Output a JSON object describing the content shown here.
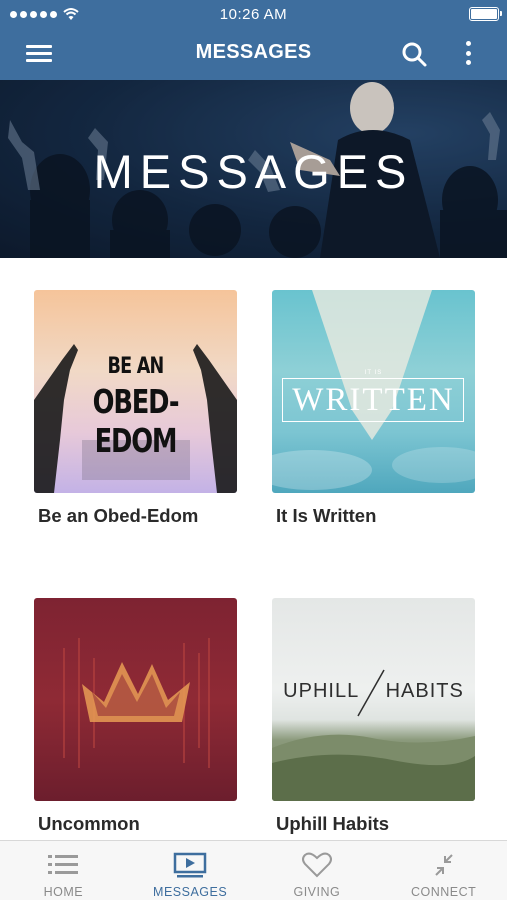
{
  "status_bar": {
    "time": "10:26 AM",
    "signal_icon": "signal-dots-icon",
    "wifi_icon": "wifi-icon",
    "battery_icon": "battery-icon"
  },
  "header": {
    "title": "MESSAGES",
    "menu_icon": "hamburger-menu-icon",
    "search_icon": "search-icon",
    "more_icon": "more-vertical-icon",
    "background": "#3e6e9e"
  },
  "hero": {
    "title": "MESSAGES"
  },
  "series": [
    {
      "title": "Be an Obed-Edom",
      "art_line1": "BE AN",
      "art_line2": "OBED-EDOM"
    },
    {
      "title": "It Is Written",
      "art_small": "IT IS",
      "art_main": "WRITTEN"
    },
    {
      "title": "Uncommon"
    },
    {
      "title": "Uphill Habits",
      "art_left": "UPHILL",
      "art_right": "HABITS"
    }
  ],
  "tabs": [
    {
      "label": "HOME",
      "icon": "list-icon",
      "active": false
    },
    {
      "label": "MESSAGES",
      "icon": "video-player-icon",
      "active": true
    },
    {
      "label": "GIVING",
      "icon": "heart-icon",
      "active": false
    },
    {
      "label": "CONNECT",
      "icon": "connect-arrows-icon",
      "active": false
    }
  ],
  "colors": {
    "accent": "#3e6e9e",
    "tab_inactive": "#8a8a8a"
  }
}
